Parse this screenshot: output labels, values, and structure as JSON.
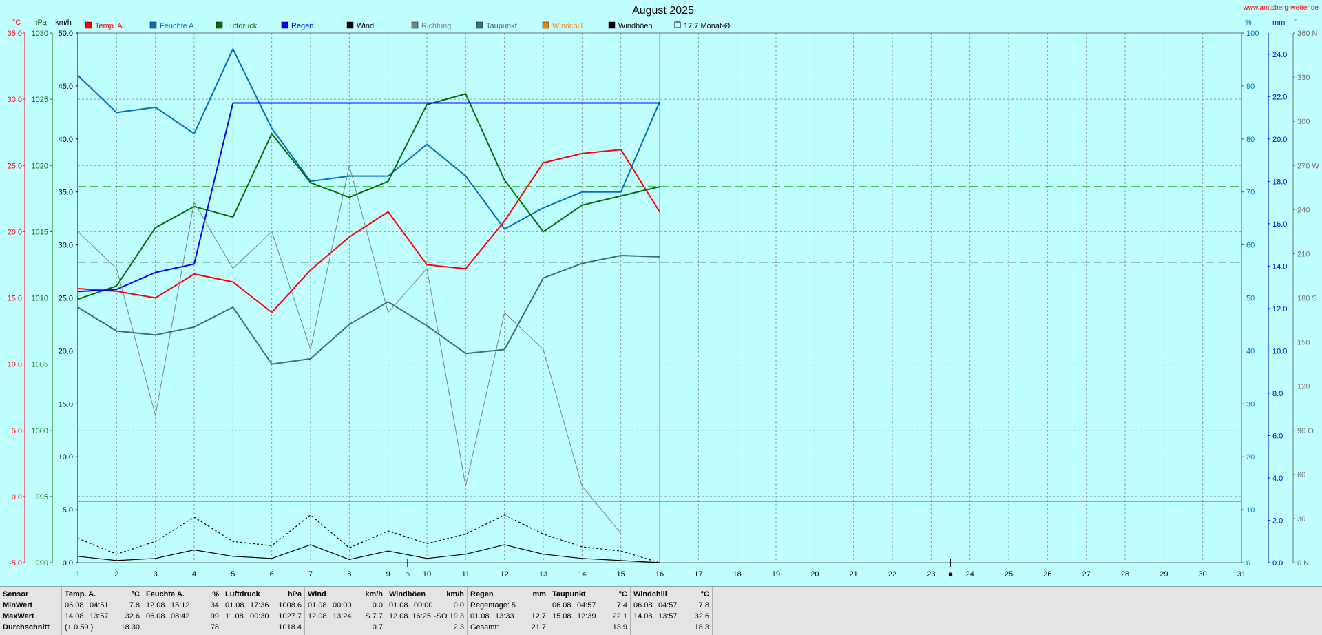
{
  "site_label": "www.amtsberg-wetter.de",
  "chart_data": {
    "type": "line",
    "title": "August 2025",
    "x": [
      1,
      2,
      3,
      4,
      5,
      6,
      7,
      8,
      9,
      10,
      11,
      12,
      13,
      14,
      15,
      16,
      17,
      18,
      19,
      20,
      21,
      22,
      23,
      24,
      25,
      26,
      27,
      28,
      29,
      30,
      31
    ],
    "axes": {
      "temp": {
        "unit_label": "°C",
        "range": [
          -5,
          35
        ],
        "ticks": [
          -5,
          0,
          5,
          10,
          15,
          20,
          25,
          30,
          35
        ],
        "tick_labels": [
          "-5.0",
          "0.0",
          "5.0",
          "10.0",
          "15.0",
          "20.0",
          "25.0",
          "30.0",
          "35.0"
        ],
        "color": "#ff0000"
      },
      "pressure": {
        "unit_label": "hPa",
        "range": [
          990,
          1030
        ],
        "ticks": [
          990,
          995,
          1000,
          1005,
          1010,
          1015,
          1020,
          1025,
          1030
        ],
        "tick_labels": [
          "990",
          "995",
          "1000",
          "1005",
          "1010",
          "1015",
          "1020",
          "1025",
          "1030"
        ],
        "color": "#007000"
      },
      "wind": {
        "unit_label": "km/h",
        "range": [
          0,
          50
        ],
        "ticks": [
          0,
          5,
          10,
          15,
          20,
          25,
          30,
          35,
          40,
          45,
          50
        ],
        "tick_labels": [
          "0.0",
          "5.0",
          "10.0",
          "15.0",
          "20.0",
          "25.0",
          "30.0",
          "35.0",
          "40.0",
          "45.0",
          "50.0"
        ],
        "color": "#000000"
      },
      "humidity": {
        "unit_label": "%",
        "range": [
          0,
          100
        ],
        "ticks": [
          0,
          10,
          20,
          30,
          40,
          50,
          60,
          70,
          80,
          90,
          100
        ],
        "tick_labels": [
          "0",
          "10",
          "20",
          "30",
          "40",
          "50",
          "60",
          "70",
          "80",
          "90",
          "100"
        ],
        "color": "#0070c0"
      },
      "rain": {
        "unit_label": "mm",
        "range": [
          0,
          25
        ],
        "ticks": [
          0,
          2,
          4,
          6,
          8,
          10,
          12,
          14,
          16,
          18,
          20,
          22,
          24
        ],
        "tick_labels": [
          "0.0",
          "2.0",
          "4.0",
          "6.0",
          "8.0",
          "10.0",
          "12.0",
          "14.0",
          "16.0",
          "18.0",
          "20.0",
          "22.0",
          "24.0"
        ],
        "color": "#0000dd"
      },
      "direction": {
        "unit_label": "°",
        "range": [
          0,
          360
        ],
        "ticks": [
          0,
          30,
          60,
          90,
          120,
          150,
          180,
          210,
          240,
          270,
          300,
          330,
          360
        ],
        "tick_labels": [
          "0 N",
          "30",
          "60",
          "90 O",
          "120",
          "150",
          "180 S",
          "210",
          "240",
          "270 W",
          "300",
          "330",
          "360 N"
        ],
        "color": "#707070"
      }
    },
    "series": [
      {
        "name": "Temp. A.",
        "axis": "temp",
        "color": "#ff0000",
        "width": 2,
        "values": [
          15.7,
          15.5,
          15.0,
          16.8,
          16.2,
          13.9,
          17.1,
          19.6,
          21.5,
          17.5,
          17.2,
          20.8,
          25.2,
          25.9,
          26.2,
          21.5
        ]
      },
      {
        "name": "Feuchte A.",
        "axis": "humidity",
        "color": "#0070c0",
        "width": 2,
        "values": [
          92,
          85,
          86,
          81,
          97,
          82,
          72,
          73,
          73,
          79,
          73,
          63,
          67,
          70,
          70,
          87
        ]
      },
      {
        "name": "Luftdruck",
        "axis": "pressure",
        "color": "#007000",
        "width": 2,
        "values": [
          1009.9,
          1010.9,
          1015.3,
          1016.9,
          1016.1,
          1022.4,
          1018.7,
          1017.6,
          1018.8,
          1024.6,
          1025.4,
          1018.9,
          1015.0,
          1017.0,
          1017.7,
          1018.4
        ]
      },
      {
        "name": "Regen",
        "axis": "rain",
        "color": "#0000ff",
        "width": 2,
        "values": [
          12.8,
          12.9,
          13.7,
          14.1,
          21.7,
          21.7,
          21.7,
          21.7,
          21.7,
          21.7,
          21.7,
          21.7,
          21.7,
          21.7,
          21.7,
          21.7
        ]
      },
      {
        "name": "Wind",
        "axis": "wind",
        "color": "#000000",
        "width": 1.2,
        "dash": "",
        "values": [
          0.6,
          0.2,
          0.4,
          1.2,
          0.6,
          0.4,
          1.7,
          0.3,
          1.1,
          0.4,
          0.8,
          1.7,
          0.8,
          0.4,
          0.2,
          0.0
        ]
      },
      {
        "name": "Richtung",
        "axis": "direction",
        "color": "#808080",
        "width": 1,
        "values": [
          225,
          200,
          100,
          245,
          200,
          225,
          145,
          270,
          170,
          200,
          52,
          170,
          145,
          52,
          20
        ]
      },
      {
        "name": "Taupunkt",
        "axis": "temp",
        "color": "#407070",
        "width": 2,
        "values": [
          14.3,
          12.5,
          12.2,
          12.8,
          14.3,
          10.0,
          10.4,
          13.0,
          14.7,
          12.9,
          10.8,
          11.1,
          16.5,
          17.6,
          18.2,
          18.1
        ]
      },
      {
        "name": "Windchill",
        "axis": "temp",
        "color": "#ff8000",
        "width": 0,
        "values": []
      },
      {
        "name": "Windböen",
        "axis": "wind",
        "color": "#000000",
        "width": 1.2,
        "dash": "3,3",
        "values": [
          2.3,
          0.8,
          2.0,
          4.3,
          2.0,
          1.6,
          4.5,
          1.4,
          3.0,
          1.8,
          2.7,
          4.5,
          2.7,
          1.5,
          1.1,
          0.0
        ]
      }
    ],
    "monthly_avg": {
      "label": "17.7 Monat-Ø",
      "value": 17.7,
      "axis": "temp"
    },
    "reference_lines": [
      {
        "axis": "pressure",
        "value": 1018.4,
        "color": "#009000",
        "dash": "12,6"
      },
      {
        "axis": "temp",
        "value": 17.7,
        "color": "#000000",
        "dash": "12,6"
      },
      {
        "axis": "rain",
        "value": 2.9,
        "color": "#5050c0",
        "dash": ""
      }
    ],
    "day_separator": 16,
    "moon_phases": [
      {
        "day": 9.5,
        "symbol": "○"
      },
      {
        "day": 23.5,
        "symbol": "●"
      }
    ],
    "grid": true
  },
  "stats": {
    "labels": {
      "sensor": "Sensor",
      "min": "MinWert",
      "max": "MaxWert",
      "avg": "Durchschnitt"
    },
    "columns": [
      {
        "name": "Temp. A.",
        "unit": "°C",
        "min": [
          "06.08.",
          "04:51",
          "7.8"
        ],
        "max": [
          "14.08.",
          "13:57",
          "32.6"
        ],
        "avg": [
          "(+ 0.59 )",
          "",
          "18.30"
        ]
      },
      {
        "name": "Feuchte A.",
        "unit": "%",
        "min": [
          "12.08.",
          "15:12",
          "34"
        ],
        "max": [
          "06.08.",
          "08:42",
          "99"
        ],
        "avg": [
          "",
          "",
          "78"
        ]
      },
      {
        "name": "Luftdruck",
        "unit": "hPa",
        "min": [
          "01.08.",
          "17:36",
          "1008.6"
        ],
        "max": [
          "11.08.",
          "00:30",
          "1027.7"
        ],
        "avg": [
          "",
          "",
          "1018.4"
        ]
      },
      {
        "name": "Wind",
        "unit": "km/h",
        "min": [
          "01.08.",
          "00:00",
          "0.0"
        ],
        "max": [
          "12.08.",
          "13:24",
          "S 7.7"
        ],
        "avg": [
          "",
          "",
          "0.7"
        ]
      },
      {
        "name": "Windböen",
        "unit": "km/h",
        "min": [
          "01.08.",
          "00:00",
          "0.0"
        ],
        "max": [
          "12.08.",
          "16:25",
          "-SO 19.3"
        ],
        "avg": [
          "",
          "",
          "2.3"
        ]
      },
      {
        "name": "Regen",
        "unit": "mm",
        "min": [
          "Regentage: 5",
          "",
          ""
        ],
        "max": [
          "01.08.",
          "13:33",
          "12.7"
        ],
        "avg": [
          "Gesamt:",
          "",
          "21.7"
        ]
      },
      {
        "name": "Taupunkt",
        "unit": "°C",
        "min": [
          "06.08.",
          "04:57",
          "7.4"
        ],
        "max": [
          "15.08.",
          "12:39",
          "22.1"
        ],
        "avg": [
          "",
          "",
          "13.9"
        ]
      },
      {
        "name": "Windchill",
        "unit": "°C",
        "min": [
          "06.08.",
          "04:57",
          "7.8"
        ],
        "max": [
          "14.08.",
          "13:57",
          "32.6"
        ],
        "avg": [
          "",
          "",
          "18.3"
        ]
      }
    ]
  }
}
